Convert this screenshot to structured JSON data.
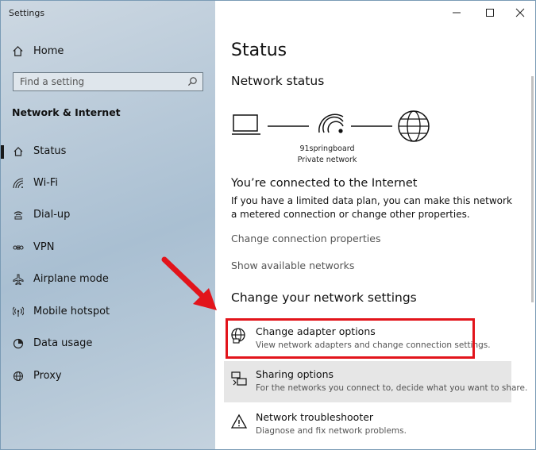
{
  "window": {
    "title": "Settings"
  },
  "sidebar": {
    "home_label": "Home",
    "search_placeholder": "Find a setting",
    "section_title": "Network & Internet",
    "items": [
      {
        "label": "Status",
        "icon": "home-status-icon",
        "selected": true
      },
      {
        "label": "Wi-Fi",
        "icon": "wifi-icon"
      },
      {
        "label": "Dial-up",
        "icon": "dialup-icon"
      },
      {
        "label": "VPN",
        "icon": "vpn-icon"
      },
      {
        "label": "Airplane mode",
        "icon": "airplane-icon"
      },
      {
        "label": "Mobile hotspot",
        "icon": "hotspot-icon"
      },
      {
        "label": "Data usage",
        "icon": "data-usage-icon"
      },
      {
        "label": "Proxy",
        "icon": "globe-icon"
      }
    ]
  },
  "main": {
    "title": "Status",
    "network_status_heading": "Network status",
    "network_name": "91springboard",
    "network_type": "Private network",
    "connected_heading": "You’re connected to the Internet",
    "connected_desc": "If you have a limited data plan, you can make this network a metered connection or change other properties.",
    "link_change_props": "Change connection properties",
    "link_show_networks": "Show available networks",
    "change_heading": "Change your network settings",
    "options": [
      {
        "title": "Change adapter options",
        "subtitle": "View network adapters and change connection settings.",
        "icon": "adapter-globe-icon"
      },
      {
        "title": "Sharing options",
        "subtitle": "For the networks you connect to, decide what you want to share.",
        "icon": "sharing-icon"
      },
      {
        "title": "Network troubleshooter",
        "subtitle": "Diagnose and fix network problems.",
        "icon": "warning-icon"
      }
    ]
  },
  "colors": {
    "highlight_box": "#e2141b",
    "arrow": "#e2141b",
    "sidebar": "#b9cad9"
  }
}
